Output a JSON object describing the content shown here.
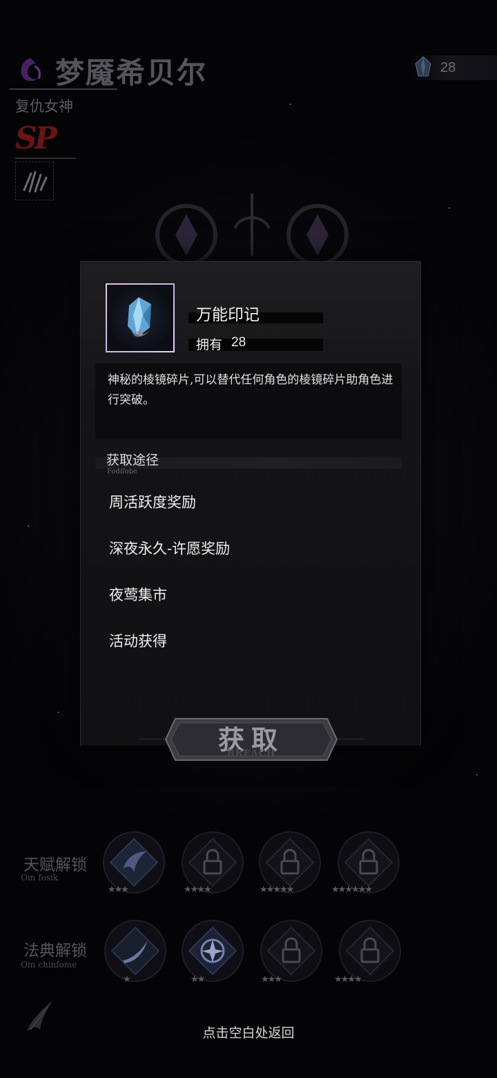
{
  "header": {
    "character_name": "梦魇希贝尔",
    "character_title": "复仇女神",
    "rank_badge": "SP",
    "currency": {
      "icon": "crystal-icon",
      "value": "28"
    }
  },
  "item_popup": {
    "name": "万能印记",
    "owned_label": "拥有",
    "owned_count": "28",
    "icon": "crystal-icon",
    "description": "神秘的棱镜碎片,可以替代任何角色的棱镜碎片助角色进行突破。",
    "sources_title": "获取途径",
    "sources_subtitle": "Fodifobe",
    "sources": [
      "周活跃度奖励",
      "深夜永久-许愿奖励",
      "夜莺集市",
      "活动获得"
    ]
  },
  "obtain_button": {
    "label": "获取",
    "sublabel": "BREACH"
  },
  "talent_unlock": {
    "label": "天赋解锁",
    "sublabel": "Oin fosik"
  },
  "codex_unlock": {
    "label": "法典解锁",
    "sublabel": "Oin chinfome"
  },
  "back_hint": "点击空白处返回",
  "colors": {
    "accent_pink": "#f1c6d8",
    "accent_lilac": "#c9b2f0",
    "brand_red": "#6b1414"
  }
}
